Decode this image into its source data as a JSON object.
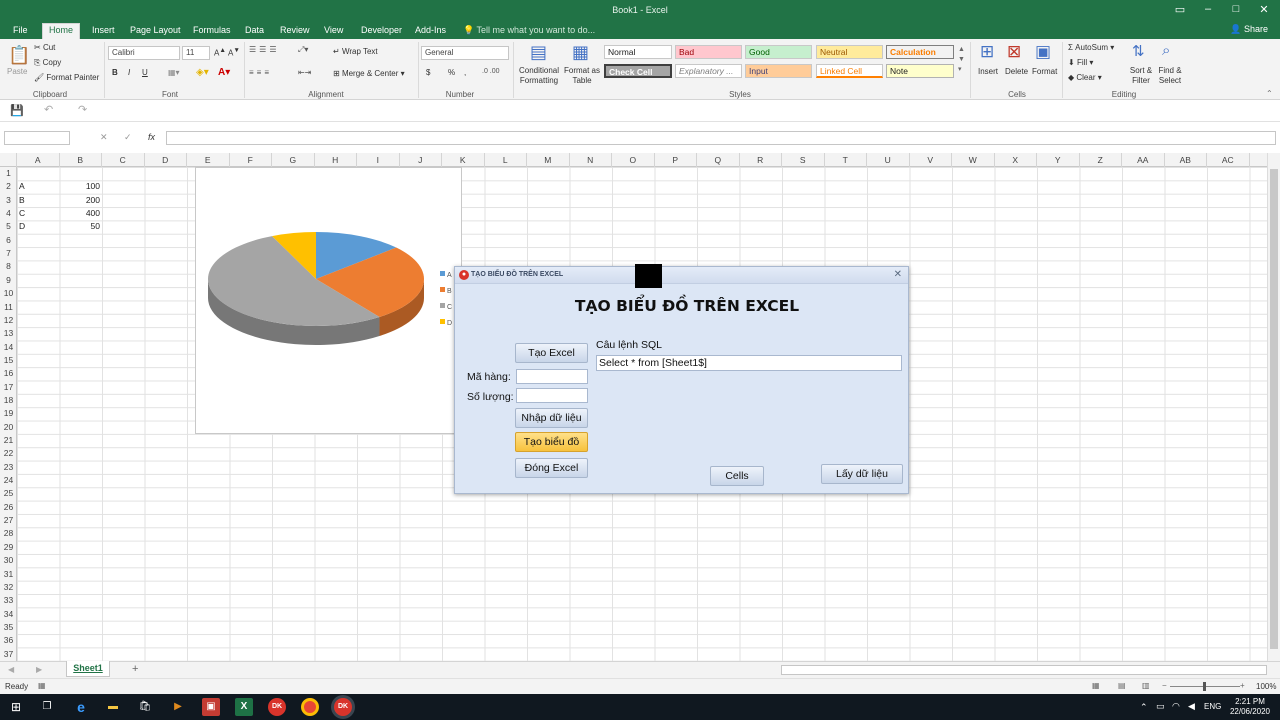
{
  "window": {
    "title": "Book1 - Excel"
  },
  "tabs": [
    "File",
    "Home",
    "Insert",
    "Page Layout",
    "Formulas",
    "Data",
    "Review",
    "View",
    "Developer",
    "Add-Ins"
  ],
  "tell_me": "Tell me what you want to do...",
  "share": "Share",
  "ribbon": {
    "clipboard": {
      "paste": "Paste",
      "cut": "Cut",
      "copy": "Copy",
      "format_painter": "Format Painter",
      "label": "Clipboard"
    },
    "font": {
      "name": "Calibri",
      "size": "11",
      "bold": "B",
      "italic": "I",
      "underline": "U",
      "label": "Font"
    },
    "alignment": {
      "wrap": "Wrap Text",
      "merge": "Merge & Center",
      "label": "Alignment"
    },
    "number": {
      "format": "General",
      "currency": "$",
      "percent": "%",
      "comma": ",",
      "label": "Number"
    },
    "styles": {
      "conditional": "Conditional Formatting",
      "format_table": "Format as Table",
      "label": "Styles",
      "cells": [
        "Normal",
        "Bad",
        "Good",
        "Neutral",
        "Calculation",
        "Check Cell",
        "Explanatory ...",
        "Input",
        "Linked Cell",
        "Note"
      ]
    },
    "cells": {
      "insert": "Insert",
      "delete": "Delete",
      "format": "Format",
      "label": "Cells"
    },
    "editing": {
      "autosum": "AutoSum",
      "fill": "Fill",
      "clear": "Clear",
      "sort": "Sort & Filter",
      "find": "Find & Select",
      "label": "Editing"
    }
  },
  "formula": {
    "fx": "fx",
    "cancel": "✕",
    "enter": "✓"
  },
  "columns": [
    "A",
    "B",
    "C",
    "D",
    "E",
    "F",
    "G",
    "H",
    "I",
    "J",
    "K",
    "L",
    "M",
    "N",
    "O",
    "P",
    "Q",
    "R",
    "S",
    "T",
    "U",
    "V",
    "W",
    "X",
    "Y",
    "Z",
    "AA",
    "AB",
    "AC"
  ],
  "rows": [
    "1",
    "2",
    "3",
    "4",
    "5",
    "6",
    "7",
    "8",
    "9",
    "10",
    "11",
    "12",
    "13",
    "14",
    "15",
    "16",
    "17",
    "18",
    "19",
    "20",
    "21",
    "22",
    "23",
    "24",
    "25",
    "26",
    "27",
    "28",
    "29",
    "30",
    "31",
    "32",
    "33",
    "34",
    "35",
    "36",
    "37"
  ],
  "cells": [
    {
      "col": "A",
      "row": 2,
      "v": "A"
    },
    {
      "col": "B",
      "row": 2,
      "v": "100"
    },
    {
      "col": "A",
      "row": 3,
      "v": "B"
    },
    {
      "col": "B",
      "row": 3,
      "v": "200"
    },
    {
      "col": "A",
      "row": 4,
      "v": "C"
    },
    {
      "col": "B",
      "row": 4,
      "v": "400"
    },
    {
      "col": "A",
      "row": 5,
      "v": "D"
    },
    {
      "col": "B",
      "row": 5,
      "v": "50"
    }
  ],
  "chart_data": {
    "type": "pie",
    "categories": [
      "A",
      "B",
      "C",
      "D"
    ],
    "values": [
      100,
      200,
      400,
      50
    ],
    "colors": [
      "#5b9bd5",
      "#ed7d31",
      "#a5a5a5",
      "#ffc000"
    ],
    "legend": "right",
    "style": "3d"
  },
  "sheet": {
    "name": "Sheet1",
    "add": "+"
  },
  "status": {
    "ready": "Ready",
    "zoom": "100%"
  },
  "taskbar": {
    "time": "2:21 PM",
    "date": "22/06/2020",
    "lang": "ENG"
  },
  "dialog": {
    "title": "TẠO BIỂU ĐỒ TRÊN EXCEL",
    "heading": "TẠO BIỂU ĐỒ TRÊN EXCEL",
    "btn_create_excel": "Tạo Excel",
    "lbl_code": "Mã hàng:",
    "lbl_qty": "Số lượng:",
    "btn_input": "Nhập dữ liệu",
    "btn_chart": "Tạo biểu đồ",
    "btn_close_excel": "Đóng Excel",
    "lbl_sql": "Câu lệnh SQL",
    "sql_value": "Select * from [Sheet1$]",
    "btn_cells": "Cells",
    "btn_fetch": "Lấy dữ liệu"
  },
  "colors": {
    "excel_green": "#217346",
    "dialog_bg": "#dce6f5",
    "highlight": "#f7c23d"
  }
}
